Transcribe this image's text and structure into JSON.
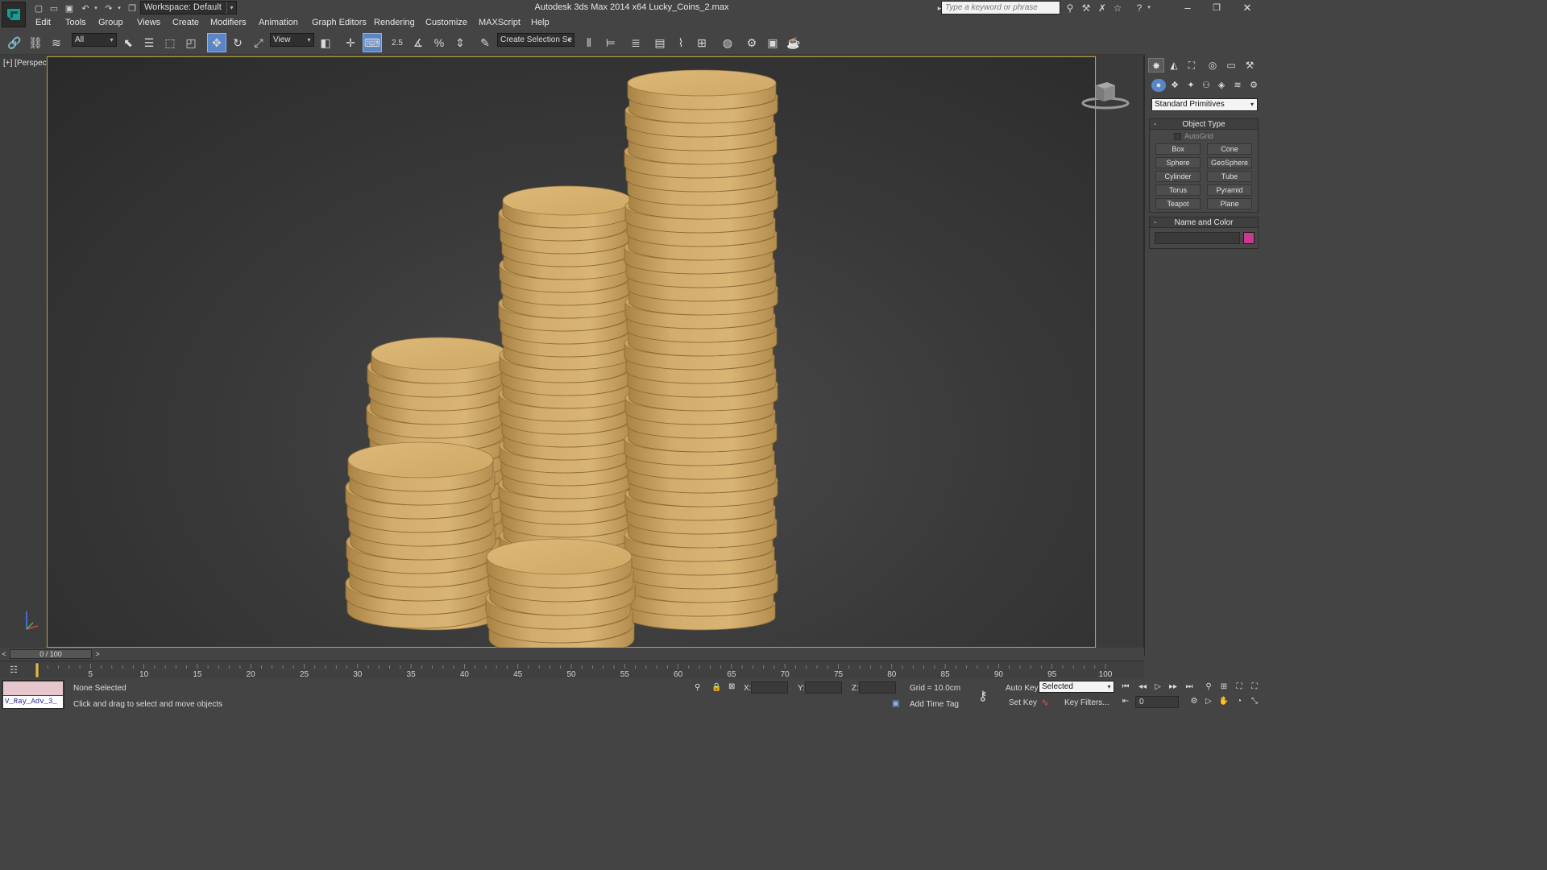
{
  "titlebar": {
    "workspace": "Workspace: Default",
    "app_title": "Autodesk 3ds Max  2014 x64     Lucky_Coins_2.max",
    "search_placeholder": "Type a keyword or phrase"
  },
  "menus": [
    "Edit",
    "Tools",
    "Group",
    "Views",
    "Create",
    "Modifiers",
    "Animation",
    "Graph Editors",
    "Rendering",
    "Customize",
    "MAXScript",
    "Help"
  ],
  "toolbar": {
    "selection_filter": "All",
    "ref_coord": "View",
    "snap_angle": "2.5",
    "selection_set_placeholder": "Create Selection Se"
  },
  "viewport": {
    "label": "[+] [Perspective ] [Shaded ]",
    "coin_color": "#d7b06e",
    "frame_color": "#b8a544"
  },
  "command_panel": {
    "category": "Standard Primitives",
    "object_type_title": "Object Type",
    "autogrid": "AutoGrid",
    "buttons": [
      "Box",
      "Cone",
      "Sphere",
      "GeoSphere",
      "Cylinder",
      "Tube",
      "Torus",
      "Pyramid",
      "Teapot",
      "Plane"
    ],
    "name_color_title": "Name and Color",
    "object_color": "#c63a8f"
  },
  "timeline": {
    "slider": "0 / 100",
    "ticks": [
      "5",
      "10",
      "15",
      "20",
      "25",
      "30",
      "35",
      "40",
      "45",
      "50",
      "55",
      "60",
      "65",
      "70",
      "75",
      "80",
      "85",
      "90",
      "95",
      "100"
    ]
  },
  "status": {
    "maxscript": "V_Ray_Adv_3_",
    "selection": "None Selected",
    "prompt": "Click and drag to select and move objects",
    "x_label": "X:",
    "y_label": "Y:",
    "z_label": "Z:",
    "grid": "Grid = 10.0cm",
    "add_time_tag": "Add Time Tag",
    "auto_key": "Auto Key",
    "set_key": "Set Key",
    "key_mode": "Selected",
    "key_filters": "Key Filters...",
    "frame": "0"
  }
}
